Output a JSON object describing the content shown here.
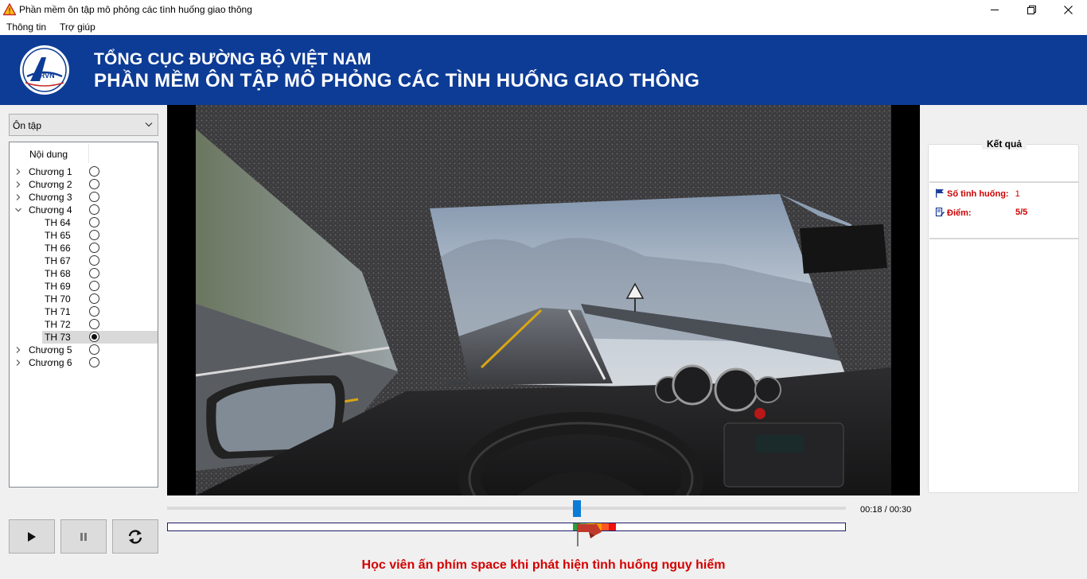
{
  "window": {
    "title": "Phần mềm ôn tập mô phỏng các tình huống giao thông",
    "icon": "warning-triangle-icon",
    "controls": [
      "minimize",
      "restore",
      "close"
    ]
  },
  "menu": {
    "info": "Thông tin",
    "help": "Trợ giúp"
  },
  "banner": {
    "logo_text": "DRVN",
    "org": "TỔNG CỤC ĐƯỜNG BỘ VIỆT NAM",
    "title": "PHẦN MỀM ÔN TẬP MÔ PHỎNG CÁC TÌNH HUỐNG GIAO THÔNG",
    "background": "#0d3c96"
  },
  "mode": {
    "selected": "Ôn tập"
  },
  "tree": {
    "header": "Nội dung",
    "rows": [
      {
        "label": "Chương 1",
        "level": 0,
        "expander": "collapsed",
        "checked": false,
        "selected": false
      },
      {
        "label": "Chương 2",
        "level": 0,
        "expander": "collapsed",
        "checked": false,
        "selected": false
      },
      {
        "label": "Chương 3",
        "level": 0,
        "expander": "collapsed",
        "checked": false,
        "selected": false
      },
      {
        "label": "Chương 4",
        "level": 0,
        "expander": "expanded",
        "checked": false,
        "selected": false
      },
      {
        "label": "TH 64",
        "level": 1,
        "expander": "none",
        "checked": false,
        "selected": false
      },
      {
        "label": "TH 65",
        "level": 1,
        "expander": "none",
        "checked": false,
        "selected": false
      },
      {
        "label": "TH 66",
        "level": 1,
        "expander": "none",
        "checked": false,
        "selected": false
      },
      {
        "label": "TH 67",
        "level": 1,
        "expander": "none",
        "checked": false,
        "selected": false
      },
      {
        "label": "TH 68",
        "level": 1,
        "expander": "none",
        "checked": false,
        "selected": false
      },
      {
        "label": "TH 69",
        "level": 1,
        "expander": "none",
        "checked": false,
        "selected": false
      },
      {
        "label": "TH 70",
        "level": 1,
        "expander": "none",
        "checked": false,
        "selected": false
      },
      {
        "label": "TH 71",
        "level": 1,
        "expander": "none",
        "checked": false,
        "selected": false
      },
      {
        "label": "TH 72",
        "level": 1,
        "expander": "none",
        "checked": false,
        "selected": false
      },
      {
        "label": "TH 73",
        "level": 1,
        "expander": "none",
        "checked": true,
        "selected": true
      },
      {
        "label": "Chương 5",
        "level": 0,
        "expander": "collapsed",
        "checked": false,
        "selected": false
      },
      {
        "label": "Chương 6",
        "level": 0,
        "expander": "collapsed",
        "checked": false,
        "selected": false
      }
    ]
  },
  "result": {
    "title": "Kết quả",
    "count_label": "Số tình huống:",
    "count_value": "1",
    "score_label": "Điểm:",
    "score_value": "5/5",
    "accent": "#cc0000"
  },
  "player": {
    "time": "00:18 / 00:30",
    "progress": 0.6,
    "thumb_color": "#0a7bd6",
    "score_zones": [
      {
        "color": "#2e9e3a",
        "value": 5
      },
      {
        "color": "#8bc34a",
        "value": 4
      },
      {
        "color": "#ffd600",
        "value": 3
      },
      {
        "color": "#ff9800",
        "value": 2
      },
      {
        "color": "#ff5722",
        "value": 1
      },
      {
        "color": "#ee1111",
        "value": 0
      }
    ],
    "flag_icon": "flag-marker-icon"
  },
  "controls": {
    "play_icon": "play-icon",
    "pause_icon": "pause-icon",
    "replay_icon": "replay-icon"
  },
  "hint": "Học viên ấn phím space khi phát hiện tình huống nguy hiểm"
}
